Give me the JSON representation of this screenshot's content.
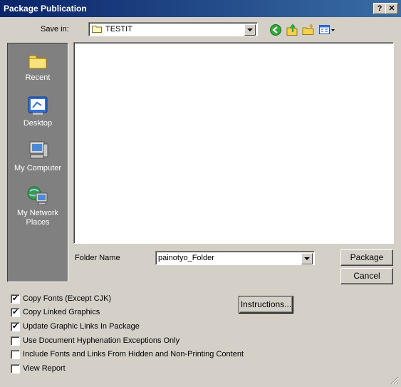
{
  "window": {
    "title": "Package Publication",
    "help_btn": "?",
    "close_btn": "✕"
  },
  "save_in": {
    "label": "Save in:",
    "value": "TESTIT"
  },
  "places": [
    {
      "label": "Recent"
    },
    {
      "label": "Desktop"
    },
    {
      "label": "My Computer"
    },
    {
      "label": "My Network Places"
    }
  ],
  "folder_name": {
    "label": "Folder Name",
    "value": "painotyo_Folder"
  },
  "buttons": {
    "package": "Package",
    "cancel": "Cancel",
    "instructions": "Instructions..."
  },
  "options": [
    {
      "label": "Copy Fonts (Except CJK)",
      "checked": true
    },
    {
      "label": "Copy Linked Graphics",
      "checked": true
    },
    {
      "label": "Update Graphic Links In Package",
      "checked": true
    },
    {
      "label": "Use Document Hyphenation Exceptions Only",
      "checked": false
    },
    {
      "label": "Include Fonts and Links From Hidden and Non-Printing Content",
      "checked": false
    },
    {
      "label": "View Report",
      "checked": false
    }
  ]
}
